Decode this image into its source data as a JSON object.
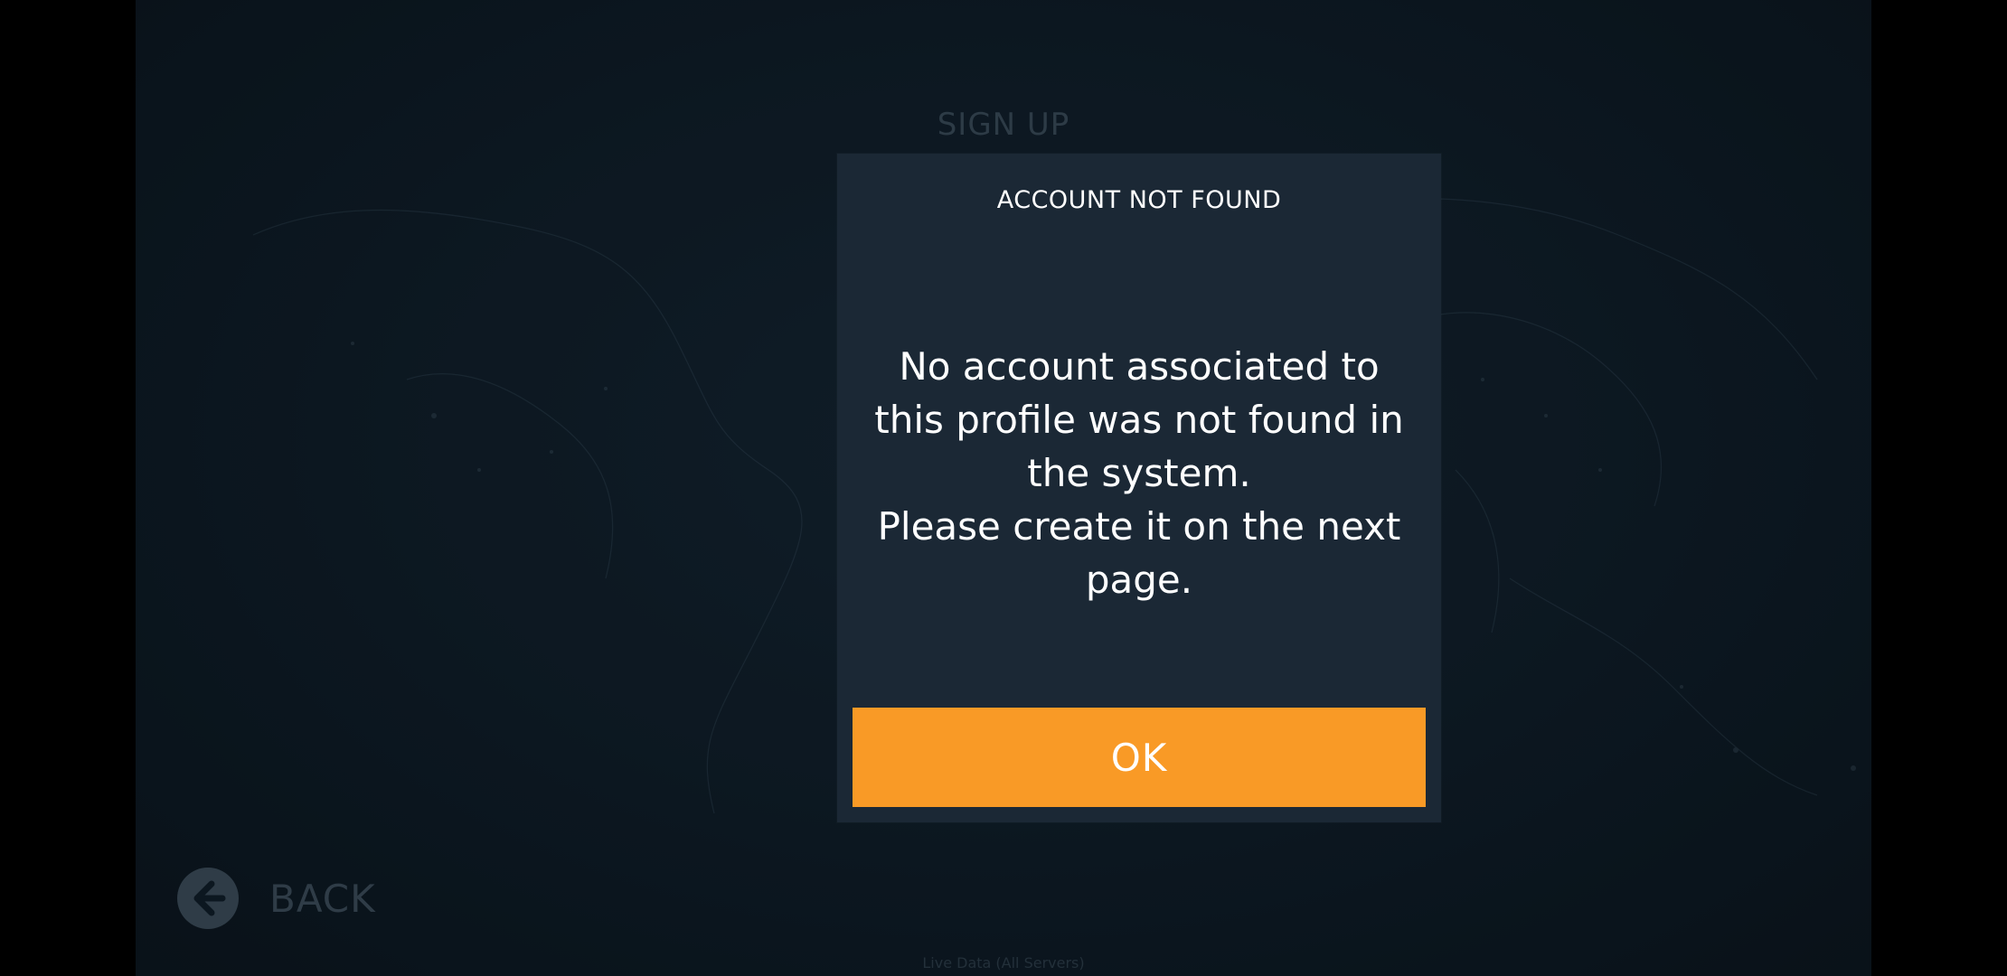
{
  "screen": {
    "title": "SIGN UP",
    "footer": "Live Data (All Servers)"
  },
  "navigation": {
    "back_label": "BACK",
    "back_icon": "arrow-left-circle-icon"
  },
  "dialog": {
    "title": "ACCOUNT NOT FOUND",
    "message": "No account associated to this profile was not found in the system.\nPlease create it on the next page.",
    "ok_label": "OK"
  },
  "colors": {
    "background": "#0f1b26",
    "dialog_background": "#1b2835",
    "accent": "#f99a26",
    "text": "#ffffff",
    "muted_text": "#3e4d5a"
  }
}
